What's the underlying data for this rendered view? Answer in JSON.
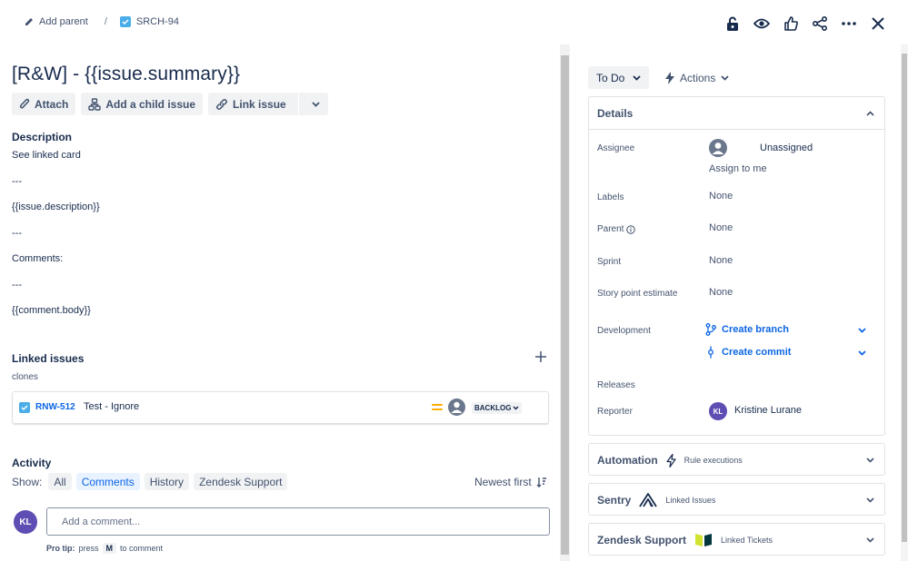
{
  "breadcrumb": {
    "add_parent": "Add parent",
    "separator": "/",
    "issue_key": "SRCH-94"
  },
  "issue": {
    "title": "[R&W] - {{issue.summary}}",
    "buttons": {
      "attach": "Attach",
      "add_child": "Add a child issue",
      "link_issue": "Link issue"
    }
  },
  "description": {
    "heading": "Description",
    "lines": [
      "See linked card",
      "---",
      "{{issue.description}}",
      "---",
      "Comments:",
      "---",
      "{{comment.body}}"
    ]
  },
  "linked_issues": {
    "heading": "Linked issues",
    "relation": "clones",
    "item": {
      "key": "RNW-512",
      "summary": "Test - Ignore",
      "status": "BACKLOG"
    }
  },
  "activity": {
    "heading": "Activity",
    "show_label": "Show:",
    "tabs": [
      "All",
      "Comments",
      "History",
      "Zendesk Support"
    ],
    "active_tab": "Comments",
    "sort": "Newest first",
    "comment_placeholder": "Add a comment...",
    "avatar_initials": "KL",
    "protip_label": "Pro tip:",
    "protip_press": "press",
    "protip_key": "M",
    "protip_rest": "to comment"
  },
  "status": {
    "value": "To Do",
    "actions": "Actions"
  },
  "details": {
    "heading": "Details",
    "assignee_label": "Assignee",
    "assignee_value": "Unassigned",
    "assign_to_me": "Assign to me",
    "labels_label": "Labels",
    "labels_value": "None",
    "parent_label": "Parent",
    "parent_value": "None",
    "sprint_label": "Sprint",
    "sprint_value": "None",
    "story_points_label": "Story point estimate",
    "story_points_value": "None",
    "development_label": "Development",
    "create_branch": "Create branch",
    "create_commit": "Create commit",
    "releases_label": "Releases",
    "reporter_label": "Reporter",
    "reporter_value": "Kristine Lurane",
    "reporter_initials": "KL"
  },
  "panels": {
    "automation": {
      "title": "Automation",
      "sub": "Rule executions"
    },
    "sentry": {
      "title": "Sentry",
      "sub": "Linked Issues"
    },
    "zendesk": {
      "title": "Zendesk Support",
      "sub": "Linked Tickets"
    }
  },
  "colors": {
    "accent": "#0c66e4",
    "avatar": "#5e4db2",
    "priority": "#ffab00",
    "checkbox": "#4bade8"
  }
}
